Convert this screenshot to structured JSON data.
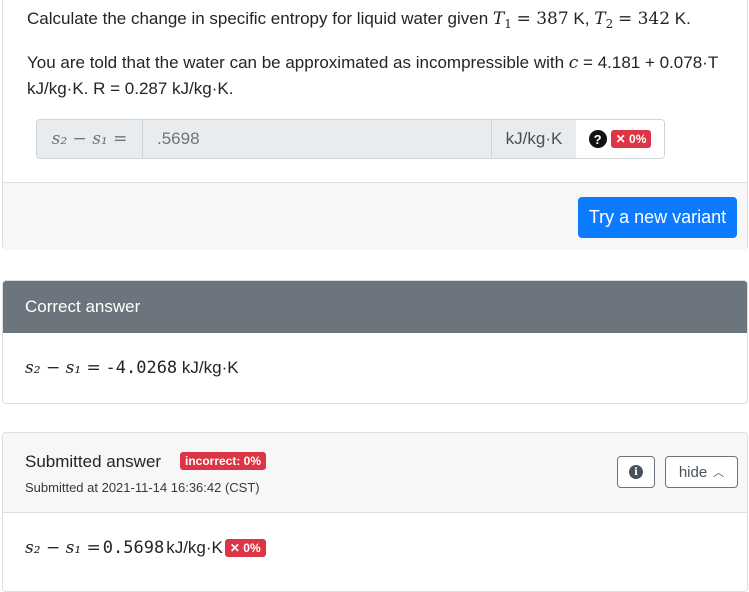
{
  "question": {
    "line1_prefix": "Calculate the change in specific entropy for liquid water given ",
    "t1_symbol": "T",
    "t1_sub": "1",
    "t1_value": "= 387",
    "t1_unit": " K, ",
    "t2_symbol": "T",
    "t2_sub": "2",
    "t2_value": "= 342",
    "t2_unit": " K.",
    "line2_prefix": "You are told that the water can be approximated as incompressible with ",
    "c_symbol": "c",
    "line2_suffix": " = 4.181 + 0.078·T",
    "line3": "kJ/kg·K. R = 0.287 kJ/kg·K."
  },
  "input_group": {
    "label": "s₂ − s₁ =",
    "value": ".5698",
    "unit": "kJ/kg·K",
    "help_icon": "question-circle-icon",
    "score_badge": "✕ 0%"
  },
  "footer": {
    "variant_button": "Try a new variant"
  },
  "correct_answer": {
    "header": "Correct answer",
    "label": "s₂ − s₁ =",
    "value": "-4.0268",
    "unit": " kJ/kg·K"
  },
  "submitted_answer": {
    "title": "Submitted answer",
    "badge": "incorrect: 0%",
    "timestamp": "Submitted at 2021-11-14 16:36:42 (CST)",
    "info_icon": "info-icon",
    "hide_label": "hide",
    "label": "s₂ − s₁ =",
    "value": "0.5698",
    "unit": " kJ/kg·K",
    "score_badge": "✕ 0%"
  },
  "colors": {
    "primary": "#0d7bff",
    "danger": "#dc3545",
    "header_gray": "#6c757d"
  }
}
